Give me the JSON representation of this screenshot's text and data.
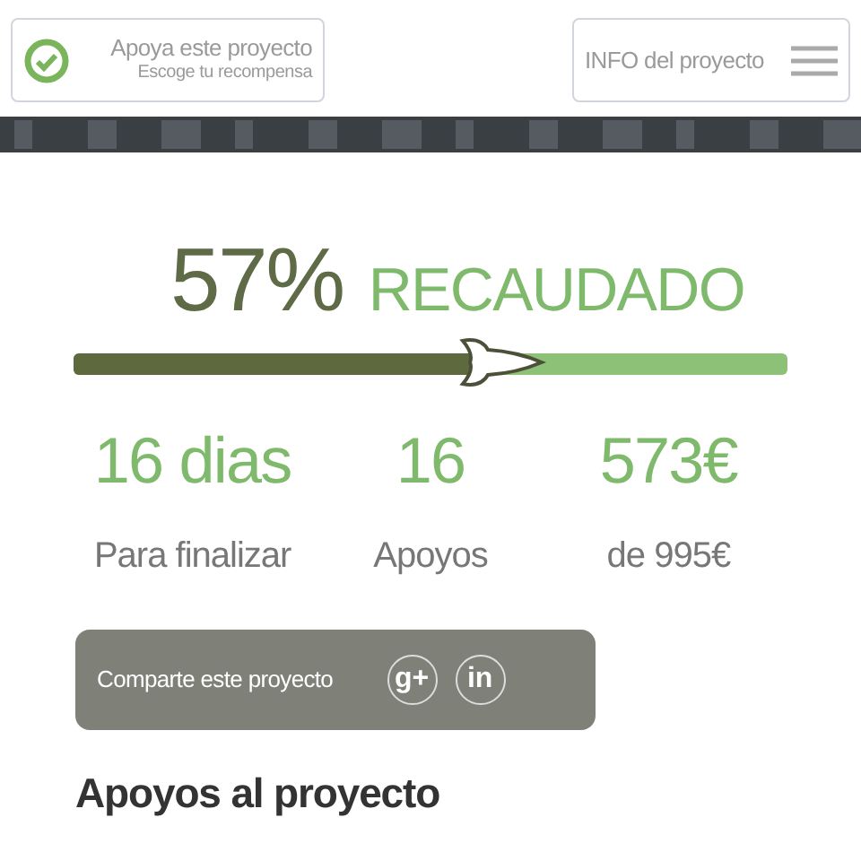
{
  "header": {
    "support_button": {
      "title": "Apoya este proyecto",
      "subtitle": "Escoge tu recompensa"
    },
    "info_button": {
      "label": "INFO del proyecto"
    }
  },
  "funding": {
    "percent": "57%",
    "label": "RECAUDADO",
    "level": 0.57
  },
  "stats": [
    {
      "value": "16 dias",
      "caption": "Para finalizar"
    },
    {
      "value": "16",
      "caption": "Apoyos"
    },
    {
      "value": "573€",
      "caption": "de 995€"
    }
  ],
  "share": {
    "label": "Comparte este proyecto",
    "icons": [
      "g+",
      "in"
    ]
  },
  "section_title": "Apoyos al proyecto"
}
